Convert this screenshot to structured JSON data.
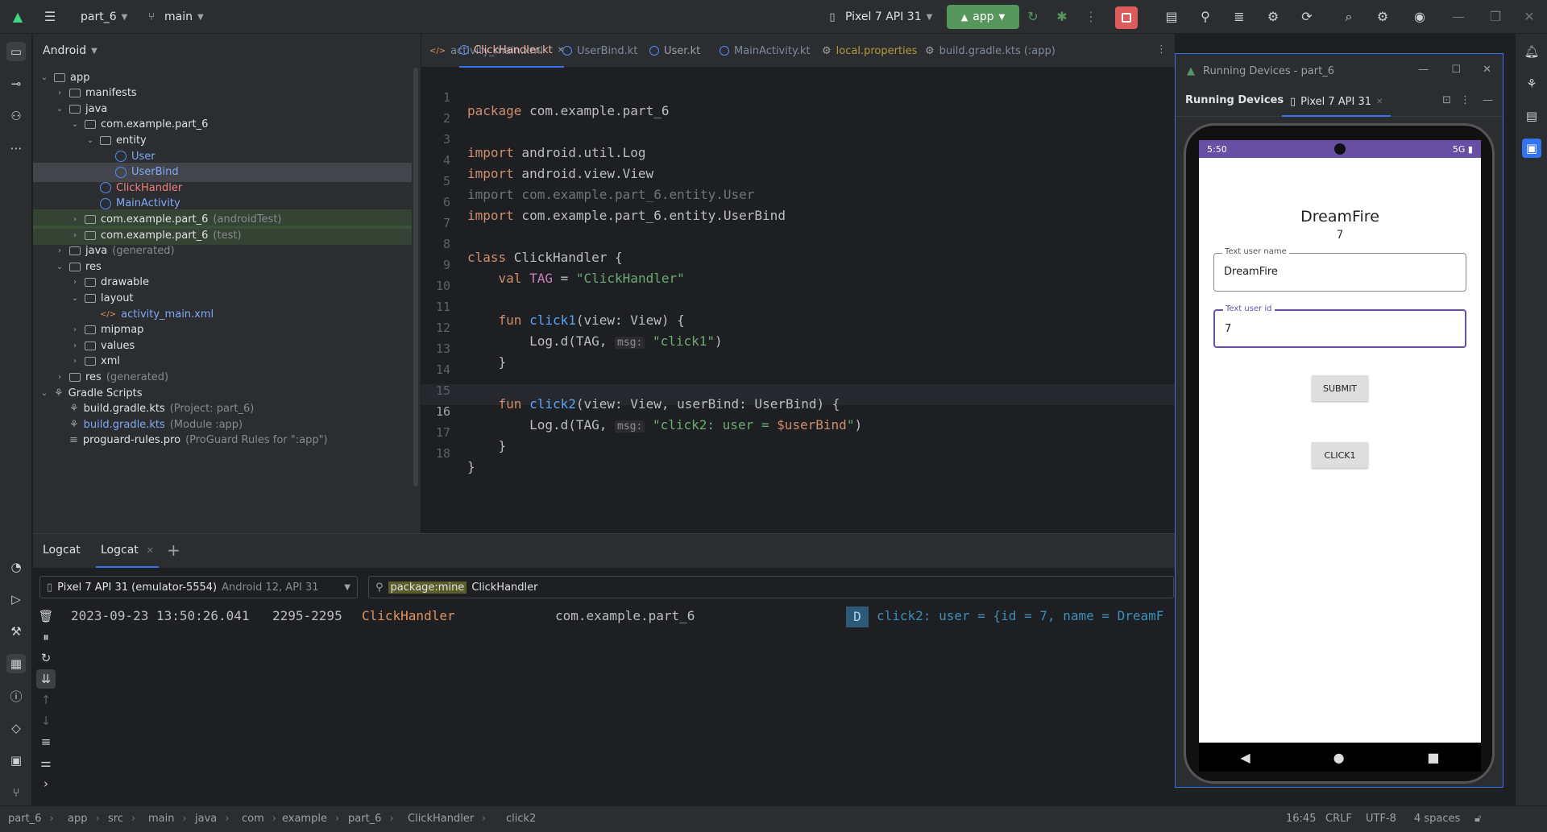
{
  "topbar": {
    "project": "part_6",
    "branch": "main",
    "device": "Pixel 7 API 31",
    "run_config": "app"
  },
  "project_panel": {
    "view_mode": "Android",
    "tree": [
      {
        "label": "app",
        "suffix": "",
        "depth": 0,
        "kind": "module"
      },
      {
        "label": "manifests",
        "suffix": "",
        "depth": 1,
        "kind": "folder"
      },
      {
        "label": "java",
        "suffix": "",
        "depth": 1,
        "kind": "folder"
      },
      {
        "label": "com.example.part_6",
        "suffix": "",
        "depth": 2,
        "kind": "folder"
      },
      {
        "label": "entity",
        "suffix": "",
        "depth": 3,
        "kind": "folder"
      },
      {
        "label": "User",
        "suffix": "",
        "depth": 4,
        "kind": "kotlin"
      },
      {
        "label": "UserBind",
        "suffix": "",
        "depth": 4,
        "kind": "kotlin"
      },
      {
        "label": "ClickHandler",
        "suffix": "",
        "depth": 3,
        "kind": "kotlin"
      },
      {
        "label": "MainActivity",
        "suffix": "",
        "depth": 3,
        "kind": "kotlin"
      },
      {
        "label": "com.example.part_6",
        "suffix": "(androidTest)",
        "depth": 2,
        "kind": "folder"
      },
      {
        "label": "com.example.part_6",
        "suffix": "(test)",
        "depth": 2,
        "kind": "folder"
      },
      {
        "label": "java",
        "suffix": "(generated)",
        "depth": 1,
        "kind": "folder"
      },
      {
        "label": "res",
        "suffix": "",
        "depth": 1,
        "kind": "folder"
      },
      {
        "label": "drawable",
        "suffix": "",
        "depth": 2,
        "kind": "folder"
      },
      {
        "label": "layout",
        "suffix": "",
        "depth": 2,
        "kind": "folder"
      },
      {
        "label": "activity_main.xml",
        "suffix": "",
        "depth": 3,
        "kind": "xml"
      },
      {
        "label": "mipmap",
        "suffix": "",
        "depth": 2,
        "kind": "folder"
      },
      {
        "label": "values",
        "suffix": "",
        "depth": 2,
        "kind": "folder"
      },
      {
        "label": "xml",
        "suffix": "",
        "depth": 2,
        "kind": "folder"
      },
      {
        "label": "res",
        "suffix": "(generated)",
        "depth": 1,
        "kind": "folder"
      },
      {
        "label": "Gradle Scripts",
        "suffix": "",
        "depth": 0,
        "kind": "gradle"
      },
      {
        "label": "build.gradle.kts",
        "suffix": "(Project: part_6)",
        "depth": 1,
        "kind": "gradle"
      },
      {
        "label": "build.gradle.kts",
        "suffix": "(Module :app)",
        "depth": 1,
        "kind": "gradle"
      },
      {
        "label": "proguard-rules.pro",
        "suffix": "(ProGuard Rules for \":app\")",
        "depth": 1,
        "kind": "file"
      }
    ]
  },
  "editor": {
    "tabs": [
      {
        "label": "activity_main.xml",
        "active": false
      },
      {
        "label": "ClickHandler.kt",
        "active": true
      },
      {
        "label": "UserBind.kt",
        "active": false
      },
      {
        "label": "User.kt",
        "active": false
      },
      {
        "label": "MainActivity.kt",
        "active": false
      },
      {
        "label": "local.properties",
        "active": false
      },
      {
        "label": "build.gradle.kts (:app)",
        "active": false
      }
    ],
    "line_numbers": [
      "1",
      "2",
      "3",
      "4",
      "5",
      "6",
      "7",
      "8",
      "9",
      "10",
      "11",
      "12",
      "13",
      "14",
      "15",
      "16",
      "17",
      "18"
    ],
    "code": {
      "l1_kw": "package",
      "l1_rest": " com.example.part_6",
      "l3_kw": "import",
      "l3_rest": " android.util.Log",
      "l4_kw": "import",
      "l4_rest": " android.view.View",
      "l5": "import com.example.part_6.entity.User",
      "l6_kw": "import",
      "l6_rest": " com.example.part_6.entity.UserBind",
      "l8_kw": "class",
      "l8_rest": " ClickHandler {",
      "l9_kw": "    val",
      "l9_name": " TAG",
      "l9_eq": " = ",
      "l9_str": "\"ClickHandler\"",
      "l11_kw": "    fun",
      "l11_fn": " click1",
      "l11_rest": "(view: View) {",
      "l12_a": "        Log.d(TAG, ",
      "l12_hint": "msg:",
      "l12_str": " \"click1\"",
      "l12_end": ")",
      "l13": "    }",
      "l15_kw": "    fun",
      "l15_fn": " click2",
      "l15_rest": "(view: View, userBind: UserBind) {",
      "l16_a": "        Log.d(TAG, ",
      "l16_hint": "msg:",
      "l16_str": " \"click2: user = ",
      "l16_var": "$userBind",
      "l16_str2": "\"",
      "l16_end": ")",
      "l17": "    }",
      "l18": "}"
    }
  },
  "logcat": {
    "tabs": [
      "Logcat",
      "Logcat"
    ],
    "device_selector": "Pixel 7 API 31 (emulator-5554)",
    "device_selector_suffix": "Android 12, API 31",
    "filter_chip": "package:mine",
    "filter_text": "ClickHandler",
    "entry": {
      "timestamp": "2023-09-23 13:50:26.041",
      "pid": "2295-2295",
      "tag": "ClickHandler",
      "package": "com.example.part_6",
      "level": "D",
      "message": "click2: user = {id = 7, name = DreamF"
    }
  },
  "devices": {
    "window_title": "Running Devices - part_6",
    "panel_label": "Running Devices",
    "device_tab": "Pixel 7 API 31",
    "phone": {
      "time": "5:50",
      "network": "5G",
      "name_text": "DreamFire",
      "id_text": "7",
      "field1_label": "Text user name",
      "field1_value": "DreamFire",
      "field2_label": "Text user id",
      "field2_value": "7",
      "submit_label": "SUBMIT",
      "click1_label": "CLICK1"
    }
  },
  "statusbar": {
    "breadcrumbs": [
      "part_6",
      "app",
      "src",
      "main",
      "java",
      "com",
      "example",
      "part_6",
      "ClickHandler",
      "click2"
    ],
    "position": "16:45",
    "line_sep": "CRLF",
    "encoding": "UTF-8",
    "indent": "4 spaces"
  },
  "colors": {
    "accent": "#3574f0",
    "run_green": "#57965c",
    "stop_red": "#db5c5c",
    "phone_status": "#6750a4"
  }
}
